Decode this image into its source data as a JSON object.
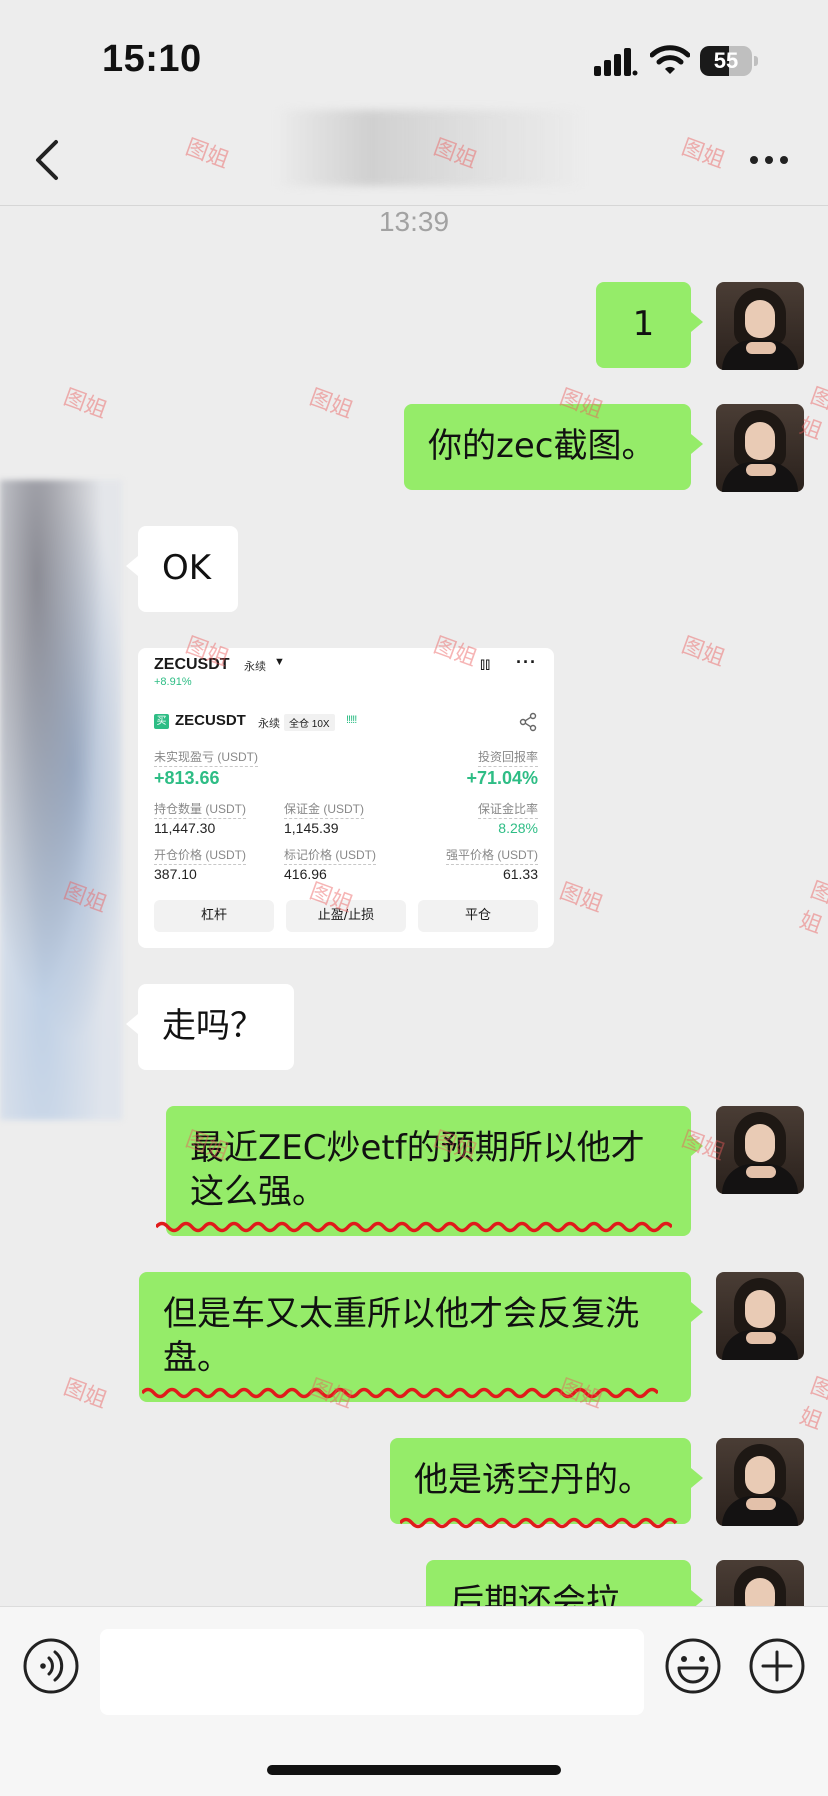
{
  "status_bar": {
    "time": "15:10",
    "battery": "55",
    "battery_level": 0.55
  },
  "nav": {
    "back_icon": "chevron-left-icon",
    "more_icon": "more-icon"
  },
  "timestamp": "13:39",
  "messages": [
    {
      "side": "right",
      "text": "1"
    },
    {
      "side": "right",
      "text": "你的zec截图。"
    },
    {
      "side": "left",
      "text": "OK"
    },
    {
      "side": "left",
      "type": "image"
    },
    {
      "side": "left",
      "text": "走吗？"
    },
    {
      "side": "right",
      "text": "最近ZEC炒etf的预期所以他才这么强。"
    },
    {
      "side": "right",
      "text": "但是车又太重所以他才会反复洗盘。"
    },
    {
      "side": "right",
      "text": "他是诱空丹的。"
    },
    {
      "side": "right",
      "text": "后期还会拉"
    }
  ],
  "card": {
    "pair": "ZECUSDT",
    "perp": "永续",
    "change": "+8.91%",
    "pair2": "ZECUSDT",
    "perp2": "永续",
    "leverage": "全仓 10X",
    "bars": "!!!!!",
    "buy": "买",
    "pnl_label": "未实现盈亏 (USDT)",
    "pnl_value": "+813.66",
    "roi_label": "投资回报率",
    "roi_value": "+71.04%",
    "size_label": "持仓数量 (USDT)",
    "size_value": "11,447.30",
    "margin_label": "保证金 (USDT)",
    "margin_value": "1,145.39",
    "margin_ratio_label": "保证金比率",
    "margin_ratio_value": "8.28%",
    "entry_label": "开仓价格 (USDT)",
    "entry_value": "387.10",
    "mark_label": "标记价格 (USDT)",
    "mark_value": "416.96",
    "liq_label": "强平价格 (USDT)",
    "liq_value": "61.33",
    "btn_leverage": "杠杆",
    "btn_tpsl": "止盈/止损",
    "btn_close": "平仓"
  },
  "watermark": "图姐",
  "colors": {
    "bubble_green": "#95ec69",
    "profit_green": "#2ebd85",
    "background": "#ededed"
  }
}
